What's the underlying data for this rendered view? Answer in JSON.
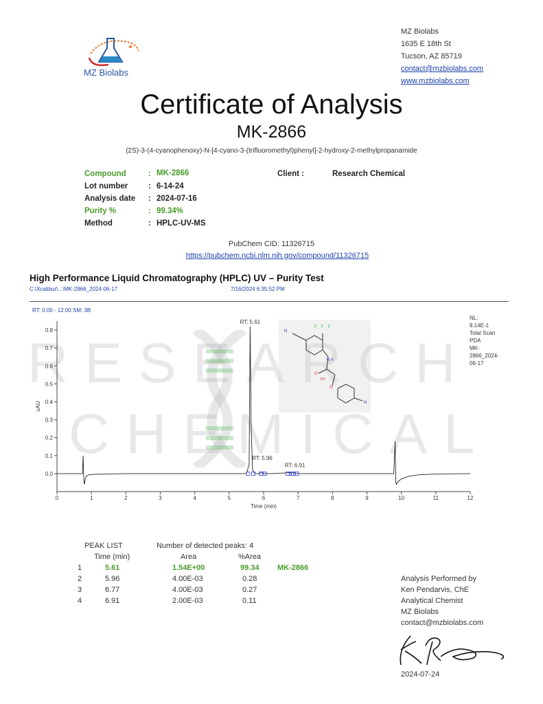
{
  "logo": {
    "text": "MZ Biolabs"
  },
  "address": {
    "line1": "MZ Biolabs",
    "line2": "1635 E 18th St",
    "line3": "Tucson, AZ 85719",
    "email": "contact@mzbiolabs.com",
    "website": "www.mzbiolabs.com"
  },
  "title": "Certificate of Analysis",
  "product": "MK-2866",
  "iupac": "(2S)-3-(4-cyanophenoxy)-N-[4-cyano-3-(trifluoromethyl)phenyl]-2-hydroxy-2-methylpropanamide",
  "info": {
    "compound_label": "Compound",
    "compound_value": "MK-2866",
    "lot_label": "Lot number",
    "lot_value": "6-14-24",
    "date_label": "Analysis date",
    "date_value": "2024-07-16",
    "purity_label": "Purity %",
    "purity_value": "99.34%",
    "method_label": "Method",
    "method_value": "HPLC-UV-MS",
    "client_label": "Client :",
    "client_value": "Research Chemical",
    "colon": ":"
  },
  "pubchem": {
    "cid": "PubChem CID: 11326715",
    "url": "https://pubchem.ncbi.nlm.nih.gov/compound/11326715"
  },
  "hplc": {
    "title": "High Performance Liquid Chromatography (HPLC) UV – Purity Test",
    "file_path": "C:\\Xcalibur\\...\\MK-2866_2024-06-17",
    "file_date": "7/16/2024 6:35:52 PM",
    "rt_range": "RT: 0.00 - 12.00  SM: 3B",
    "nl_lines": [
      "NL:",
      "8.14E-1",
      "Total Scan",
      "PDA",
      "MK-",
      "2866_2024-",
      "06-17"
    ]
  },
  "watermark": {
    "line1": "RESEARCH",
    "line2": "CHEMICAL"
  },
  "chart_data": {
    "type": "line",
    "xlabel": "Time (min)",
    "ylabel": "uAU",
    "xlim": [
      0,
      12
    ],
    "ylim": [
      -0.1,
      0.85
    ],
    "x_ticks": [
      "0",
      "1",
      "2",
      "3",
      "4",
      "5",
      "6",
      "7",
      "8",
      "9",
      "10",
      "11",
      "12"
    ],
    "y_ticks": [
      "0.0",
      "0.1",
      "0.2",
      "0.3",
      "0.4",
      "0.5",
      "0.6",
      "0.7",
      "0.8"
    ],
    "y_tick_values": [
      0,
      0.1,
      0.2,
      0.3,
      0.4,
      0.5,
      0.6,
      0.7,
      0.8
    ],
    "series": [
      {
        "x": [
          0,
          0.74,
          0.76,
          0.78,
          0.8,
          0.82,
          0.85,
          0.9,
          1.0,
          1.2,
          2,
          4,
          5,
          5.5,
          5.58,
          5.61,
          5.64,
          5.68,
          5.75,
          5.9,
          5.96,
          6.0,
          6.2,
          6.77,
          6.91,
          7,
          8,
          9,
          9.78,
          9.82,
          9.84,
          9.86,
          9.9,
          10.0,
          10.2,
          10.5,
          11,
          12
        ],
        "y": [
          0,
          0,
          0.1,
          -0.04,
          -0.06,
          -0.03,
          -0.015,
          -0.008,
          -0.005,
          -0.003,
          0,
          0,
          0,
          0,
          0.05,
          0.82,
          0.25,
          0.02,
          0,
          0,
          0.01,
          0,
          0,
          0.005,
          0.003,
          0,
          0,
          0,
          0,
          0.18,
          -0.05,
          -0.06,
          -0.045,
          -0.03,
          -0.015,
          -0.007,
          -0.002,
          0
        ]
      }
    ],
    "peak_labels": [
      {
        "x": 5.61,
        "y": 0.82,
        "text": "RT: 5.61"
      },
      {
        "x": 5.96,
        "y": 0.06,
        "text": "RT: 5.96"
      },
      {
        "x": 6.91,
        "y": 0.02,
        "text": "RT: 6.91"
      }
    ]
  },
  "peak_list": {
    "title": "PEAK LIST",
    "detected": "Number of detected peaks: 4",
    "headers": [
      "Time (min)",
      "Area",
      "%Area"
    ],
    "rows": [
      {
        "n": "1",
        "time": "5.61",
        "area": "1.54E+00",
        "pct": "99.34",
        "name": "MK-2866"
      },
      {
        "n": "2",
        "time": "5.96",
        "area": "4.00E-03",
        "pct": "0.28",
        "name": ""
      },
      {
        "n": "3",
        "time": "6.77",
        "area": "4.00E-03",
        "pct": "0.27",
        "name": ""
      },
      {
        "n": "4",
        "time": "6.91",
        "area": "2.00E-03",
        "pct": "0.11",
        "name": ""
      }
    ]
  },
  "analyst": {
    "line1": "Analysis Performed by",
    "line2": "Ken Pendarvis, ChE",
    "line3": "Analytical Chemist",
    "line4": "MZ Biolabs",
    "line5": "contact@mzbiolabs.com",
    "date": "2024-07-24"
  },
  "structure": {
    "labels": [
      "N",
      "F",
      "F",
      "F",
      "N",
      "H",
      "O",
      "OH",
      "O",
      "N"
    ]
  }
}
